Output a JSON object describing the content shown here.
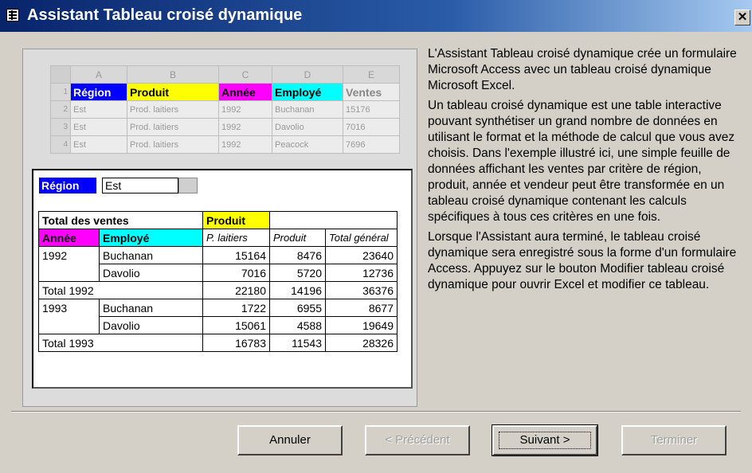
{
  "window": {
    "title": "Assistant Tableau croisé dynamique",
    "close_glyph": "✕"
  },
  "sheet": {
    "columns": [
      "A",
      "B",
      "C",
      "D",
      "E"
    ],
    "rows": [
      {
        "num": "1",
        "cells": [
          "Région",
          "Produit",
          "Année",
          "Employé",
          "Ventes"
        ]
      },
      {
        "num": "2",
        "cells": [
          "Est",
          "Prod. laitiers",
          "1992",
          "Buchanan",
          "15176"
        ]
      },
      {
        "num": "3",
        "cells": [
          "Est",
          "Prod. laitiers",
          "1992",
          "Davolio",
          "7016"
        ]
      },
      {
        "num": "4",
        "cells": [
          "Est",
          "Prod. laitiers",
          "1992",
          "Peacock",
          "7696"
        ]
      }
    ]
  },
  "pivot": {
    "page_field": "Région",
    "page_value": "Est",
    "data_field": "Total des ventes",
    "column_field": "Produit",
    "row_fields": [
      "Année",
      "Employé"
    ],
    "col_headers": [
      "P. laitiers",
      "Produit",
      "Total général"
    ],
    "rows": [
      {
        "year": "1992",
        "emp": "Buchanan",
        "v": [
          "15164",
          "8476",
          "23640"
        ]
      },
      {
        "year": "",
        "emp": "Davolio",
        "v": [
          "7016",
          "5720",
          "12736"
        ]
      },
      {
        "total": "Total 1992",
        "v": [
          "22180",
          "14196",
          "36376"
        ]
      },
      {
        "year": "1993",
        "emp": "Buchanan",
        "v": [
          "1722",
          "6955",
          "8677"
        ]
      },
      {
        "year": "",
        "emp": "Davolio",
        "v": [
          "15061",
          "4588",
          "19649"
        ]
      },
      {
        "total": "Total 1993",
        "v": [
          "16783",
          "11543",
          "28326"
        ]
      }
    ]
  },
  "description": [
    "L'Assistant Tableau croisé dynamique crée un formulaire Microsoft Access avec un tableau croisé dynamique Microsoft Excel.",
    "Un tableau croisé dynamique est une table interactive pouvant synthétiser un grand nombre de données en utilisant le format et la méthode de calcul que vous avez choisis. Dans l'exemple illustré ici, une simple feuille de données affichant les ventes par critère de région, produit, année et vendeur peut être transformée en un tableau croisé dynamique contenant les calculs spécifiques à tous ces critères en une fois.",
    "Lorsque l'Assistant aura terminé, le tableau croisé dynamique sera enregistré sous la forme d'un formulaire Access.  Appuyez sur le bouton Modifier tableau croisé dynamique pour ouvrir Excel et modifier ce tableau."
  ],
  "buttons": {
    "cancel": "Annuler",
    "previous": "< Précédent",
    "next": "Suivant >",
    "finish": "Terminer"
  }
}
